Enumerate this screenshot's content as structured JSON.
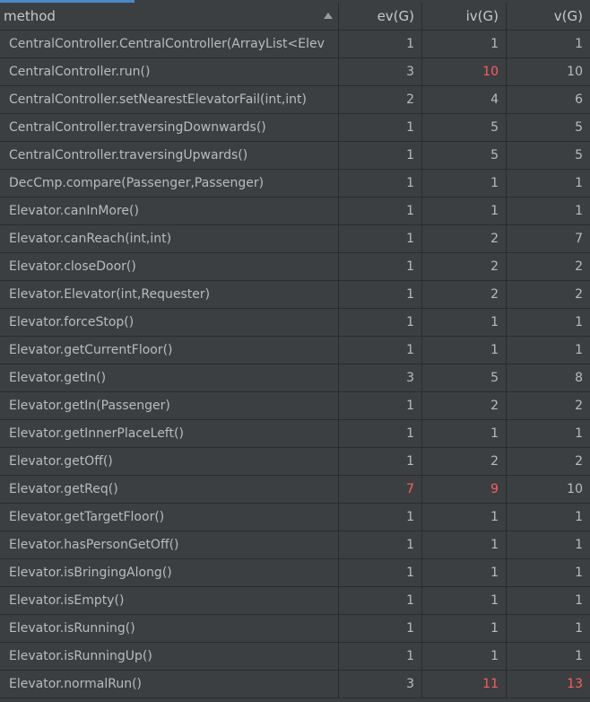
{
  "columns": {
    "method": "method",
    "ev": "ev(G)",
    "iv": "iv(G)",
    "v": "v(G)"
  },
  "colors": {
    "highlight": "#ff5c5c",
    "text": "#bbbbbb",
    "background": "#3c3f41"
  },
  "rows": [
    {
      "method": "CentralController.CentralController(ArrayList<Elev",
      "ev": "1",
      "iv": "1",
      "v": "1",
      "hi": []
    },
    {
      "method": "CentralController.run()",
      "ev": "3",
      "iv": "10",
      "v": "10",
      "hi": [
        "iv"
      ]
    },
    {
      "method": "CentralController.setNearestElevatorFail(int,int)",
      "ev": "2",
      "iv": "4",
      "v": "6",
      "hi": []
    },
    {
      "method": "CentralController.traversingDownwards()",
      "ev": "1",
      "iv": "5",
      "v": "5",
      "hi": []
    },
    {
      "method": "CentralController.traversingUpwards()",
      "ev": "1",
      "iv": "5",
      "v": "5",
      "hi": []
    },
    {
      "method": "DecCmp.compare(Passenger,Passenger)",
      "ev": "1",
      "iv": "1",
      "v": "1",
      "hi": []
    },
    {
      "method": "Elevator.canInMore()",
      "ev": "1",
      "iv": "1",
      "v": "1",
      "hi": []
    },
    {
      "method": "Elevator.canReach(int,int)",
      "ev": "1",
      "iv": "2",
      "v": "7",
      "hi": []
    },
    {
      "method": "Elevator.closeDoor()",
      "ev": "1",
      "iv": "2",
      "v": "2",
      "hi": []
    },
    {
      "method": "Elevator.Elevator(int,Requester)",
      "ev": "1",
      "iv": "2",
      "v": "2",
      "hi": []
    },
    {
      "method": "Elevator.forceStop()",
      "ev": "1",
      "iv": "1",
      "v": "1",
      "hi": []
    },
    {
      "method": "Elevator.getCurrentFloor()",
      "ev": "1",
      "iv": "1",
      "v": "1",
      "hi": []
    },
    {
      "method": "Elevator.getIn()",
      "ev": "3",
      "iv": "5",
      "v": "8",
      "hi": []
    },
    {
      "method": "Elevator.getIn(Passenger)",
      "ev": "1",
      "iv": "2",
      "v": "2",
      "hi": []
    },
    {
      "method": "Elevator.getInnerPlaceLeft()",
      "ev": "1",
      "iv": "1",
      "v": "1",
      "hi": []
    },
    {
      "method": "Elevator.getOff()",
      "ev": "1",
      "iv": "2",
      "v": "2",
      "hi": []
    },
    {
      "method": "Elevator.getReq()",
      "ev": "7",
      "iv": "9",
      "v": "10",
      "hi": [
        "ev",
        "iv"
      ]
    },
    {
      "method": "Elevator.getTargetFloor()",
      "ev": "1",
      "iv": "1",
      "v": "1",
      "hi": []
    },
    {
      "method": "Elevator.hasPersonGetOff()",
      "ev": "1",
      "iv": "1",
      "v": "1",
      "hi": []
    },
    {
      "method": "Elevator.isBringingAlong()",
      "ev": "1",
      "iv": "1",
      "v": "1",
      "hi": []
    },
    {
      "method": "Elevator.isEmpty()",
      "ev": "1",
      "iv": "1",
      "v": "1",
      "hi": []
    },
    {
      "method": "Elevator.isRunning()",
      "ev": "1",
      "iv": "1",
      "v": "1",
      "hi": []
    },
    {
      "method": "Elevator.isRunningUp()",
      "ev": "1",
      "iv": "1",
      "v": "1",
      "hi": []
    },
    {
      "method": "Elevator.normalRun()",
      "ev": "3",
      "iv": "11",
      "v": "13",
      "hi": [
        "iv",
        "v"
      ]
    }
  ]
}
